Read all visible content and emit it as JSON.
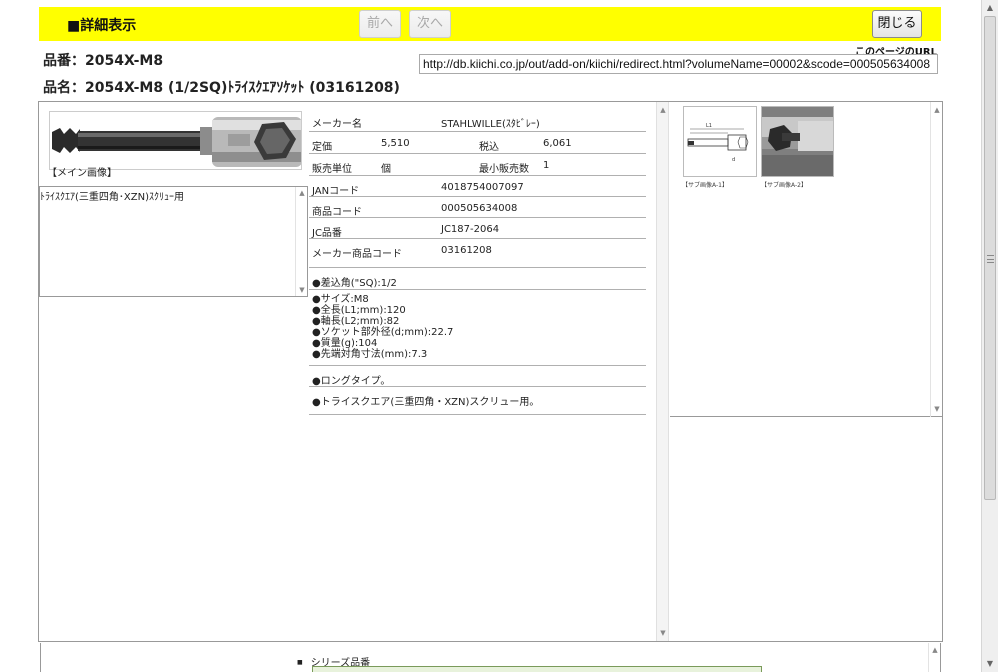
{
  "header": {
    "title": "■詳細表示",
    "prev_label": "前へ",
    "next_label": "次へ",
    "close_label": "閉じる"
  },
  "product": {
    "hinban": "品番：2054X-M8",
    "hinmei": "品名：2054X-M8 (1/2SQ)ﾄﾗｲｽｸｴｱｿｹｯﾄ (03161208)"
  },
  "page_url": {
    "label": "このページのURL",
    "value": "http://db.kiichi.co.jp/out/add-on/kiichi/redirect.html?volumeName=00002&scode=000505634008"
  },
  "main_image": {
    "caption": "【メイン画像】"
  },
  "note": "ﾄﾗｲｽｸｴｱ(三重四角･XZN)ｽｸﾘｭｰ用",
  "spec": {
    "maker_label": "メーカー名",
    "maker_value": "STAHLWILLE(ｽﾀﾋﾞﾚｰ)",
    "price_label": "定価",
    "price_value": "5,510",
    "tax_label": "税込",
    "tax_value": "6,061",
    "unit_label": "販売単位",
    "unit_value": "個",
    "min_label": "最小販売数",
    "min_value": "1",
    "jan_label": "JANコード",
    "jan_value": "4018754007097",
    "code_label": "商品コード",
    "code_value": "000505634008",
    "jc_label": "JC品番",
    "jc_value": "JC187-2064",
    "makercode_label": "メーカー商品コード",
    "makercode_value": "03161208",
    "feature1": "●差込角(\"SQ):1/2",
    "dims": [
      "●サイズ:M8",
      "●全長(L1;mm):120",
      "●軸長(L2;mm):82",
      "●ソケット部外径(d;mm):22.7",
      "●質量(g):104",
      "●先端対角寸法(mm):7.3"
    ],
    "feature2": "●ロングタイプ。",
    "feature3": "●トライスクエア(三重四角・XZN)スクリュー用。"
  },
  "sub_images": [
    {
      "caption": "【サブ画像A-1】"
    },
    {
      "caption": "【サブ画像A-2】"
    }
  ],
  "series": {
    "label": "シリーズ品番"
  },
  "icons": {
    "up": "up-arrow-icon",
    "down": "down-arrow-icon"
  },
  "colors": {
    "header_bg": "#ffff00",
    "series_border": "#7a9a5a"
  }
}
